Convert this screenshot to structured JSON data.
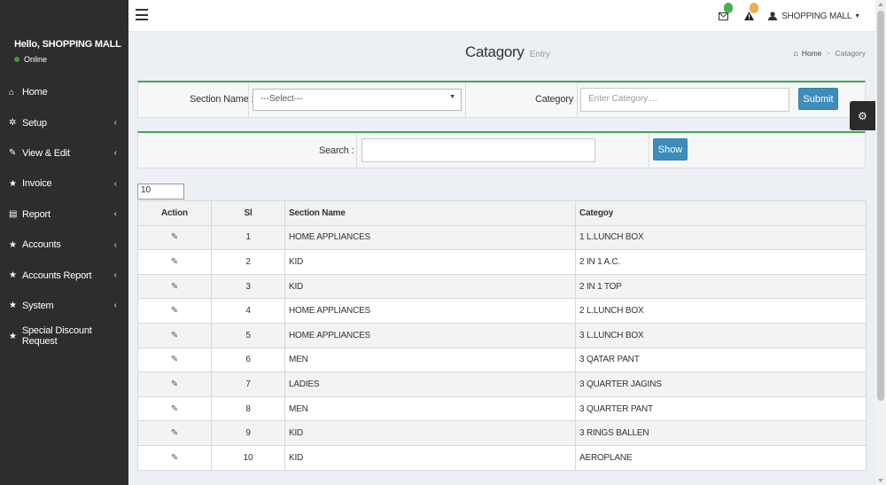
{
  "sidebar": {
    "user_name": "Hello, SHOPPING MALL",
    "user_status": "Online",
    "items": [
      {
        "label": "Home",
        "icon": "home-icon",
        "glyph": "⌂",
        "chevron": false
      },
      {
        "label": "Setup",
        "icon": "cogs-icon",
        "glyph": "✲",
        "chevron": true
      },
      {
        "label": "View & Edit",
        "icon": "edit-icon",
        "glyph": "✎",
        "chevron": true
      },
      {
        "label": "Invoice",
        "icon": "star-icon",
        "glyph": "★",
        "chevron": true
      },
      {
        "label": "Report",
        "icon": "file-icon",
        "glyph": "▤",
        "chevron": true
      },
      {
        "label": "Accounts",
        "icon": "star-icon",
        "glyph": "★",
        "chevron": true
      },
      {
        "label": "Accounts Report",
        "icon": "star-icon",
        "glyph": "★",
        "chevron": true
      },
      {
        "label": "System",
        "icon": "star-icon",
        "glyph": "★",
        "chevron": true
      },
      {
        "label": "Special Discount Request",
        "icon": "star-icon",
        "glyph": "★",
        "chevron": false
      }
    ]
  },
  "header": {
    "user_menu_label": "SHOPPING MALL",
    "badge_colors": {
      "messages": "#4caf50",
      "alerts": "#f0ad4e"
    }
  },
  "page": {
    "title": "Catagory",
    "subtitle": "Entry",
    "breadcrumb": [
      "Home",
      "Catagory"
    ]
  },
  "entry_form": {
    "section_label": "Section Name :",
    "section_value": "---Select---",
    "category_label": "Category :",
    "category_placeholder": "Enter Category....",
    "submit_label": "Submit"
  },
  "search_form": {
    "search_label": "Search :",
    "search_value": "",
    "show_label": "Show"
  },
  "table": {
    "page_size": "10",
    "headers": [
      "Action",
      "Sl",
      "Section Name",
      "Categoy"
    ],
    "rows": [
      {
        "sl": "1",
        "section": "HOME APPLIANCES",
        "category": "1 L.LUNCH BOX"
      },
      {
        "sl": "2",
        "section": "KID",
        "category": "2 IN 1 A.C."
      },
      {
        "sl": "3",
        "section": "KID",
        "category": "2 IN 1 TOP"
      },
      {
        "sl": "4",
        "section": "HOME APPLIANCES",
        "category": "2 L.LUNCH BOX"
      },
      {
        "sl": "5",
        "section": "HOME APPLIANCES",
        "category": "3 L.LUNCH BOX"
      },
      {
        "sl": "6",
        "section": "MEN",
        "category": "3 QATAR PANT"
      },
      {
        "sl": "7",
        "section": "LADIES",
        "category": "3 QUARTER JAGINS"
      },
      {
        "sl": "8",
        "section": "MEN",
        "category": "3 QUARTER PANT"
      },
      {
        "sl": "9",
        "section": "KID",
        "category": "3 RINGS BALLEN"
      },
      {
        "sl": "10",
        "section": "KID",
        "category": "AEROPLANE"
      }
    ]
  },
  "colors": {
    "sidebar_bg": "#2d2d2d",
    "panel_top_border": "#3fa35a",
    "button_primary": "#3c8dbc"
  }
}
